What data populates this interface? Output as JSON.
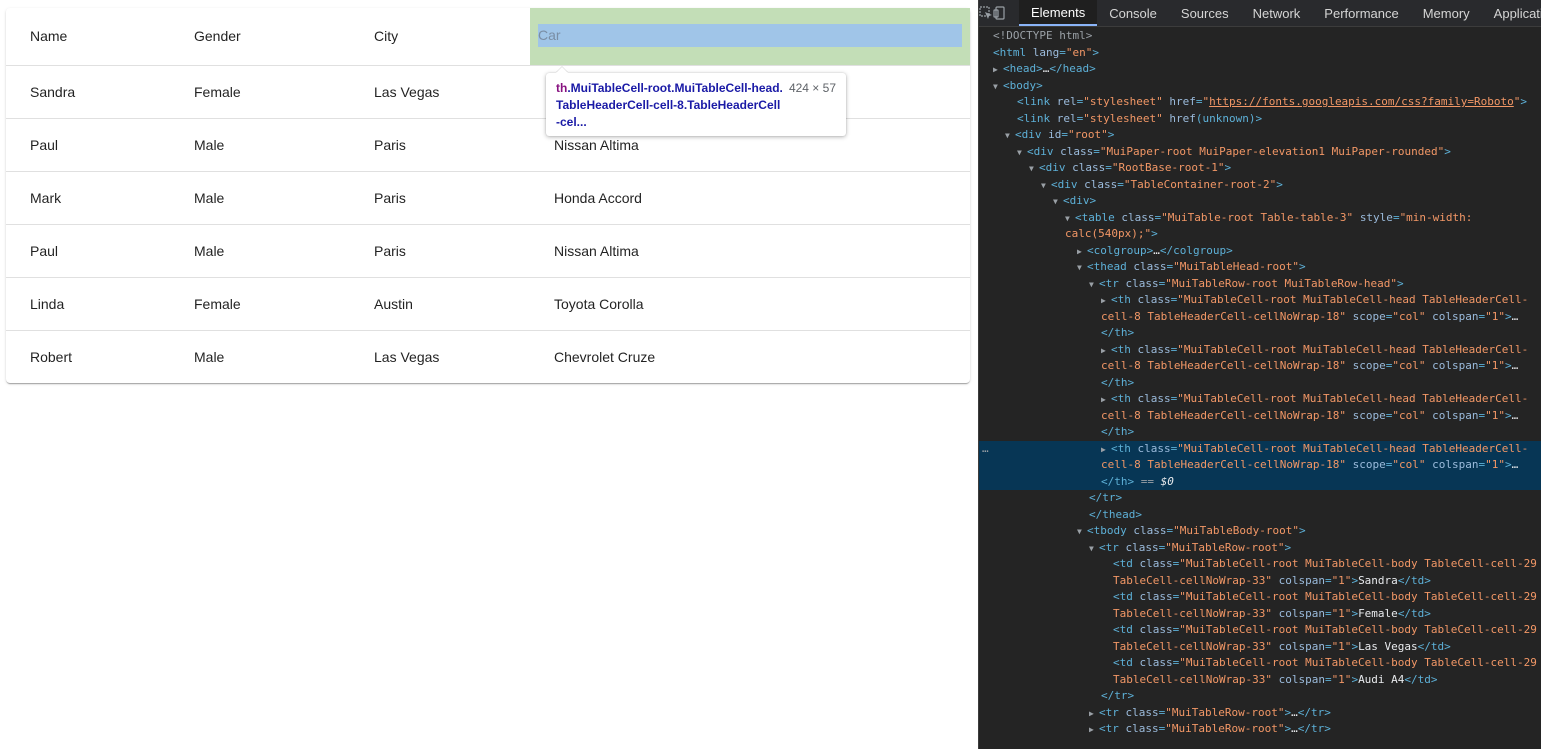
{
  "table": {
    "headers": {
      "name": "Name",
      "gender": "Gender",
      "city": "City",
      "car": "Car"
    },
    "rows": [
      [
        "Sandra",
        "Female",
        "Las Vegas",
        "Audi A4"
      ],
      [
        "Paul",
        "Male",
        "Paris",
        "Nissan Altima"
      ],
      [
        "Mark",
        "Male",
        "Paris",
        "Honda Accord"
      ],
      [
        "Paul",
        "Male",
        "Paris",
        "Nissan Altima"
      ],
      [
        "Linda",
        "Female",
        "Austin",
        "Toyota Corolla"
      ],
      [
        "Robert",
        "Male",
        "Las Vegas",
        "Chevrolet Cruze"
      ]
    ]
  },
  "tooltip": {
    "tag": "th",
    "selector": ".MuiTableCell-root.MuiTableCell-head.TableHeaderCell-cell-8.TableHeaderCell-cel...",
    "dimensions": "424 × 57"
  },
  "devtools": {
    "tabs": [
      "Elements",
      "Console",
      "Sources",
      "Network",
      "Performance",
      "Memory",
      "Application"
    ],
    "active_tab": "Elements",
    "icons": [
      "inspect-element-icon",
      "device-toolbar-icon"
    ]
  },
  "colors": {
    "inspect_padding": "#c3deb7",
    "inspect_content": "#a0c5e8",
    "devtools_bg": "#242424",
    "selected_node_bg": "#073655"
  }
}
